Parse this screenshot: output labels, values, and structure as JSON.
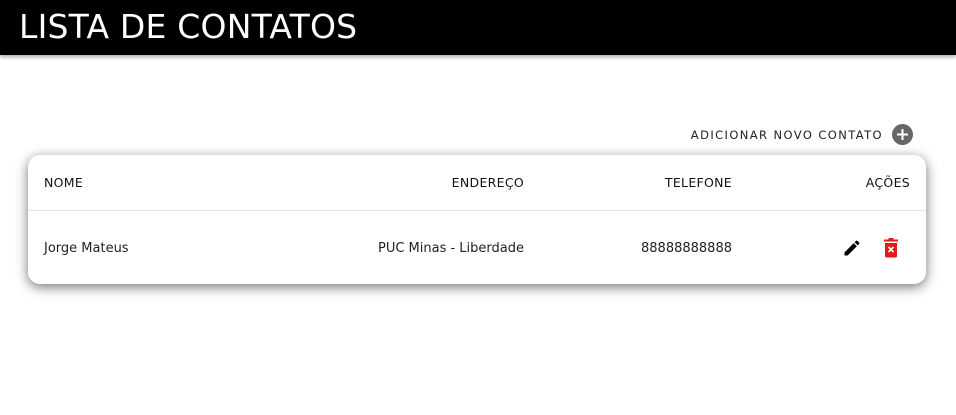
{
  "header": {
    "title": "LISTA DE CONTATOS"
  },
  "toolbar": {
    "add_label": "ADICIONAR NOVO CONTATO",
    "add_icon": "plus-circle-icon"
  },
  "table": {
    "columns": [
      "NOME",
      "ENDEREÇO",
      "TELEFONE",
      "AÇÕES"
    ],
    "rows": [
      {
        "nome": "Jorge Mateus",
        "endereco": "PUC Minas - Liberdade",
        "telefone": "88888888888",
        "actions": {
          "edit_icon": "pencil-icon",
          "delete_icon": "trash-icon"
        }
      }
    ]
  },
  "colors": {
    "header_bg": "#000000",
    "delete": "#e21b1b",
    "add_icon_bg": "#666666"
  }
}
